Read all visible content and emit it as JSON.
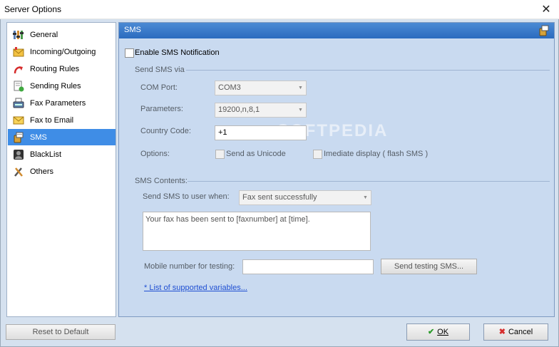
{
  "window": {
    "title": "Server Options",
    "close_glyph": "✕"
  },
  "sidebar": {
    "items": [
      {
        "label": "General",
        "icon": "general-settings-icon"
      },
      {
        "label": "Incoming/Outgoing",
        "icon": "envelope-icon"
      },
      {
        "label": "Routing Rules",
        "icon": "routing-arrow-icon"
      },
      {
        "label": "Sending Rules",
        "icon": "document-rules-icon"
      },
      {
        "label": "Fax Parameters",
        "icon": "fax-machine-icon"
      },
      {
        "label": "Fax to Email",
        "icon": "mail-icon"
      },
      {
        "label": "SMS",
        "icon": "sms-phone-icon",
        "selected": true
      },
      {
        "label": "BlackList",
        "icon": "blacklist-user-icon"
      },
      {
        "label": "Others",
        "icon": "tools-icon"
      }
    ]
  },
  "panel": {
    "title": "SMS",
    "enable_label": "Enable SMS Notification",
    "send_via": {
      "group_title": "Send SMS via",
      "com_port_label": "COM Port:",
      "com_port_value": "COM3",
      "parameters_label": "Parameters:",
      "parameters_value": "19200,n,8,1",
      "country_code_label": "Country Code:",
      "country_code_value": "+1",
      "options_label": "Options:",
      "unicode_label": "Send as Unicode",
      "flash_label": "Imediate display ( flash SMS )"
    },
    "contents": {
      "group_title": "SMS Contents:",
      "send_when_label": "Send SMS to user when:",
      "send_when_value": "Fax sent successfully",
      "message": "Your fax has been sent to [faxnumber] at [time].",
      "mobile_label": "Mobile number for testing:",
      "mobile_value": "",
      "send_test_button": "Send testing SMS...",
      "variables_link": "* List of supported variables..."
    }
  },
  "footer": {
    "reset_button": "Reset to Default",
    "ok_button": "OK",
    "cancel_button": "Cancel"
  },
  "watermark": "SOFTPEDIA",
  "colors": {
    "selected": "#3f8de6",
    "header": "#2b6bbf",
    "panel": "#c9daf0",
    "link": "#1f4fd2"
  }
}
